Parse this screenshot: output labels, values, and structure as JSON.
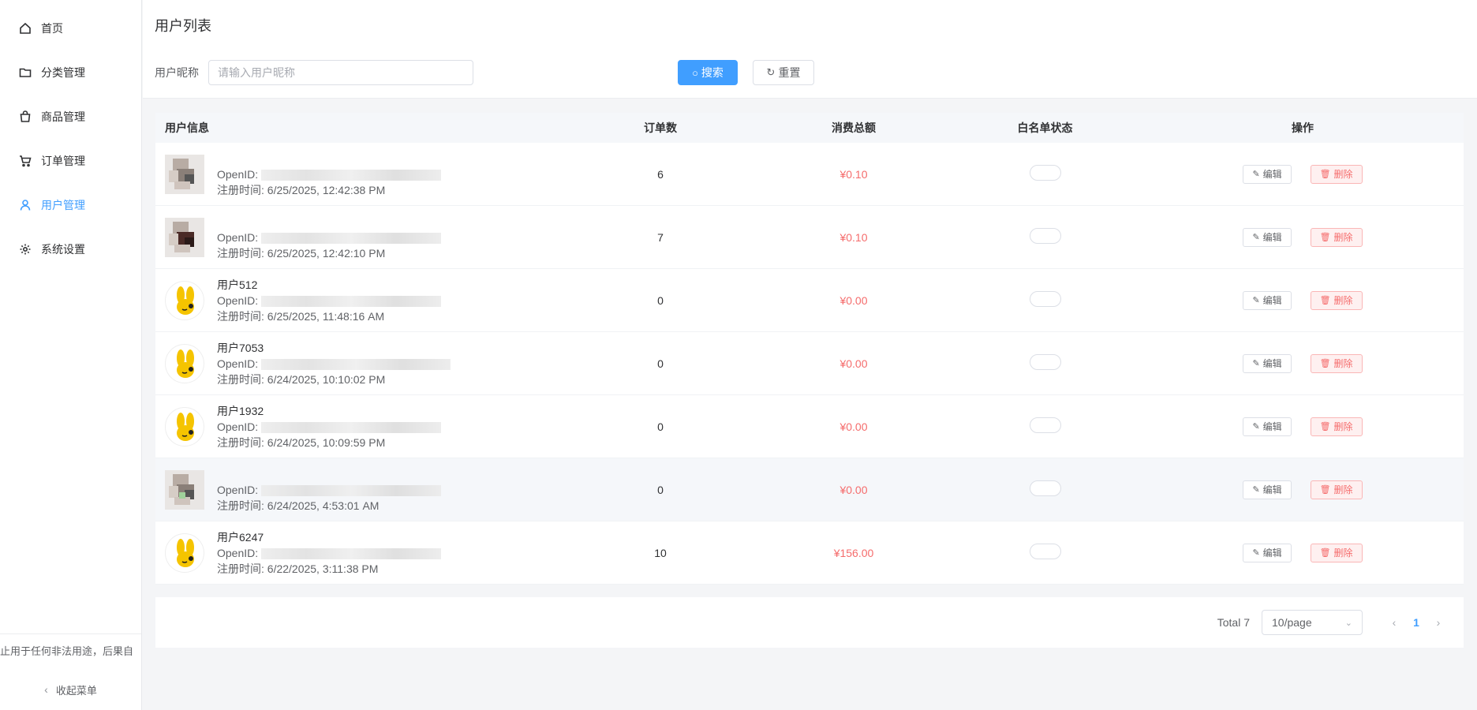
{
  "sidebar": {
    "items": [
      {
        "label": "首页",
        "icon": "home-icon"
      },
      {
        "label": "分类管理",
        "icon": "folder-icon"
      },
      {
        "label": "商品管理",
        "icon": "bag-icon"
      },
      {
        "label": "订单管理",
        "icon": "cart-icon"
      },
      {
        "label": "用户管理",
        "icon": "user-icon",
        "active": true
      },
      {
        "label": "系统设置",
        "icon": "gear-icon"
      }
    ],
    "disclaimer": "止用于任何非法用途，后果自",
    "collapse_label": "收起菜单"
  },
  "header": {
    "title": "用户列表",
    "search_label": "用户昵称",
    "search_placeholder": "请输入用户昵称",
    "search_button": "搜索",
    "reset_button": "重置"
  },
  "table": {
    "columns": [
      "用户信息",
      "订单数",
      "消费总额",
      "白名单状态",
      "操作"
    ],
    "edit_label": "编辑",
    "delete_label": "删除",
    "openid_prefix": "OpenID:",
    "rows": [
      {
        "name": "",
        "avatar": "pixelated",
        "regtime": "注册时间: 6/25/2025, 12:42:38 PM",
        "orders": "6",
        "spend": "¥0.10",
        "whitelist": false
      },
      {
        "name": "",
        "avatar": "pixelated",
        "regtime": "注册时间: 6/25/2025, 12:42:10 PM",
        "orders": "7",
        "spend": "¥0.10",
        "whitelist": false
      },
      {
        "name": "用户512",
        "avatar": "bunny",
        "regtime": "注册时间: 6/25/2025, 11:48:16 AM",
        "orders": "0",
        "spend": "¥0.00",
        "whitelist": false
      },
      {
        "name": "用户7053",
        "avatar": "bunny",
        "regtime": "注册时间: 6/24/2025, 10:10:02 PM",
        "orders": "0",
        "spend": "¥0.00",
        "whitelist": false
      },
      {
        "name": "用户1932",
        "avatar": "bunny",
        "regtime": "注册时间: 6/24/2025, 10:09:59 PM",
        "orders": "0",
        "spend": "¥0.00",
        "whitelist": false
      },
      {
        "name": "",
        "avatar": "pixelated",
        "regtime": "注册时间: 6/24/2025, 4:53:01 AM",
        "orders": "0",
        "spend": "¥0.00",
        "whitelist": false
      },
      {
        "name": "用户6247",
        "avatar": "bunny",
        "regtime": "注册时间: 6/22/2025, 3:11:38 PM",
        "orders": "10",
        "spend": "¥156.00",
        "whitelist": false
      }
    ]
  },
  "pagination": {
    "total": "Total 7",
    "page_size": "10/page",
    "current": "1"
  },
  "colors": {
    "primary": "#409eff",
    "danger": "#f56c6c"
  }
}
